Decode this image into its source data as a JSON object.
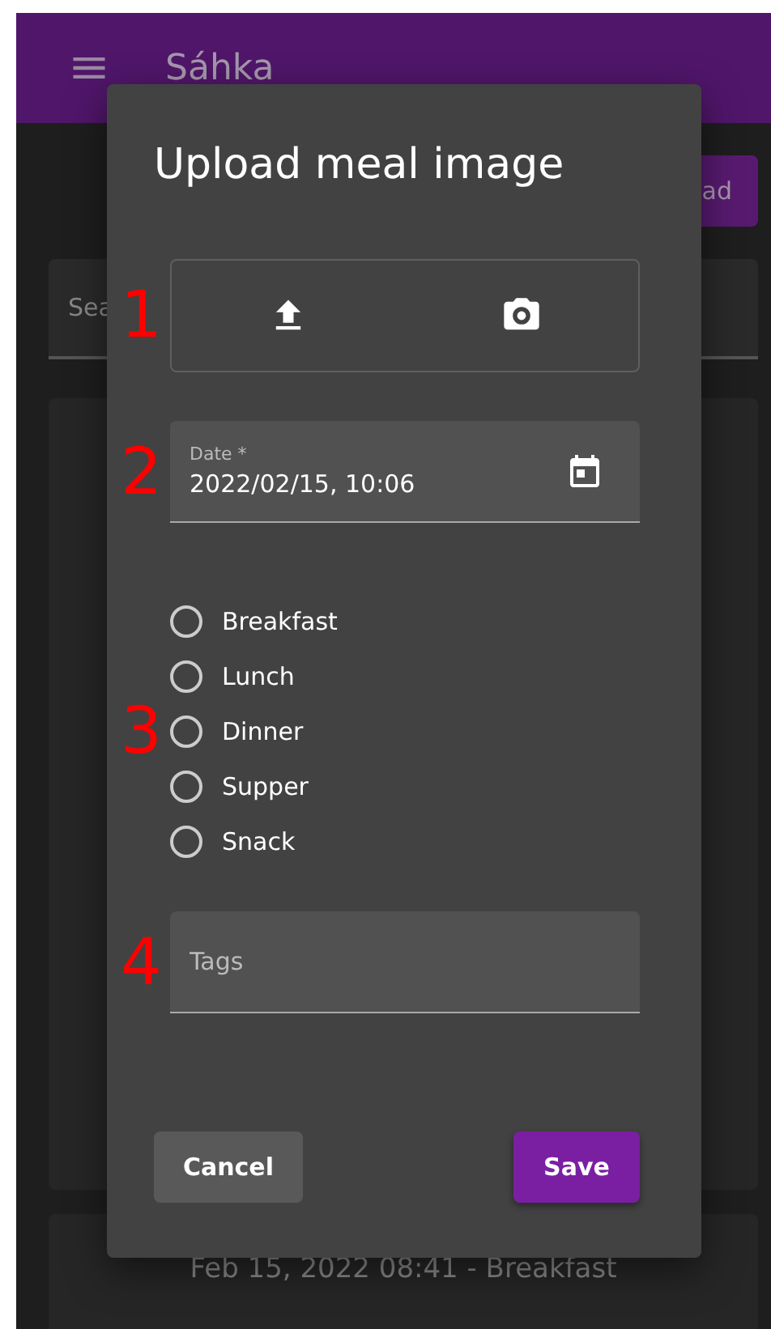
{
  "app_bar": {
    "title": "Sáhka"
  },
  "background": {
    "upload_button": "ad",
    "search_placeholder": "Sea",
    "entry_caption": "Feb 15, 2022 08:41 - Breakfast"
  },
  "dialog": {
    "title": "Upload meal image",
    "sections": [
      {
        "annotation": "1",
        "kind": "image_source"
      },
      {
        "annotation": "2",
        "kind": "date",
        "label": "Date *",
        "value": "2022/02/15, 10:06"
      },
      {
        "annotation": "3",
        "kind": "radios",
        "options": [
          {
            "label": "Breakfast",
            "selected": false
          },
          {
            "label": "Lunch",
            "selected": false
          },
          {
            "label": "Dinner",
            "selected": false
          },
          {
            "label": "Supper",
            "selected": false
          },
          {
            "label": "Snack",
            "selected": false
          }
        ]
      },
      {
        "annotation": "4",
        "kind": "text",
        "placeholder": "Tags"
      }
    ],
    "buttons": [
      {
        "label": "Cancel",
        "kind": "secondary"
      },
      {
        "label": "Save",
        "kind": "primary"
      }
    ]
  }
}
